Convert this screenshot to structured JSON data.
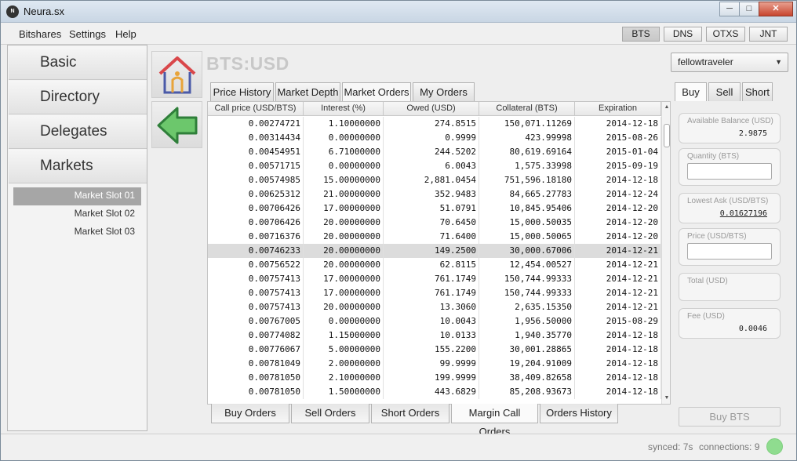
{
  "window": {
    "title": "Neura.sx",
    "icon": "app-logo-icon"
  },
  "window_controls": [
    "minimize",
    "maximize",
    "close"
  ],
  "menu": {
    "items": [
      "Bitshares",
      "Settings",
      "Help"
    ]
  },
  "market_switch": {
    "items": [
      "BTS",
      "DNS",
      "OTXS",
      "JNT"
    ],
    "active": "BTS"
  },
  "nav": {
    "items": [
      "Basic",
      "Directory",
      "Delegates",
      "Markets"
    ]
  },
  "slots": {
    "items": [
      "Market Slot 01",
      "Market Slot 02",
      "Market Slot 03"
    ],
    "active": "Market Slot 01"
  },
  "side_icons": [
    "home-icon",
    "back-arrow-icon"
  ],
  "market": {
    "title": "BTS:USD"
  },
  "account": {
    "selected": "fellowtraveler"
  },
  "tabs": {
    "items": [
      "Price History",
      "Market Depth",
      "Market Orders",
      "My Orders"
    ],
    "active": "Market Orders"
  },
  "table": {
    "columns": [
      "Call price (USD/BTS)",
      "Interest (%)",
      "Owed (USD)",
      "Collateral (BTS)",
      "Expiration"
    ],
    "selected_row": 9,
    "rows": [
      [
        "0.00274721",
        "1.10000000",
        "274.8515",
        "150,071.11269",
        "2014-12-18"
      ],
      [
        "0.00314434",
        "0.00000000",
        "0.9999",
        "423.99998",
        "2015-08-26"
      ],
      [
        "0.00454951",
        "6.71000000",
        "244.5202",
        "80,619.69164",
        "2015-01-04"
      ],
      [
        "0.00571715",
        "0.00000000",
        "6.0043",
        "1,575.33998",
        "2015-09-19"
      ],
      [
        "0.00574985",
        "15.00000000",
        "2,881.0454",
        "751,596.18180",
        "2014-12-18"
      ],
      [
        "0.00625312",
        "21.00000000",
        "352.9483",
        "84,665.27783",
        "2014-12-24"
      ],
      [
        "0.00706426",
        "17.00000000",
        "51.0791",
        "10,845.95406",
        "2014-12-20"
      ],
      [
        "0.00706426",
        "20.00000000",
        "70.6450",
        "15,000.50035",
        "2014-12-20"
      ],
      [
        "0.00716376",
        "20.00000000",
        "71.6400",
        "15,000.50065",
        "2014-12-20"
      ],
      [
        "0.00746233",
        "20.00000000",
        "149.2500",
        "30,000.67006",
        "2014-12-21"
      ],
      [
        "0.00756522",
        "20.00000000",
        "62.8115",
        "12,454.00527",
        "2014-12-21"
      ],
      [
        "0.00757413",
        "17.00000000",
        "761.1749",
        "150,744.99333",
        "2014-12-21"
      ],
      [
        "0.00757413",
        "17.00000000",
        "761.1749",
        "150,744.99333",
        "2014-12-21"
      ],
      [
        "0.00757413",
        "20.00000000",
        "13.3060",
        "2,635.15350",
        "2014-12-21"
      ],
      [
        "0.00767005",
        "0.00000000",
        "10.0043",
        "1,956.50000",
        "2015-08-29"
      ],
      [
        "0.00774082",
        "1.15000000",
        "10.0133",
        "1,940.35770",
        "2014-12-18"
      ],
      [
        "0.00776067",
        "5.00000000",
        "155.2200",
        "30,001.28865",
        "2014-12-18"
      ],
      [
        "0.00781049",
        "2.00000000",
        "99.9999",
        "19,204.91009",
        "2014-12-18"
      ],
      [
        "0.00781050",
        "2.10000000",
        "199.9999",
        "38,409.82658",
        "2014-12-18"
      ],
      [
        "0.00781050",
        "1.50000000",
        "443.6829",
        "85,208.93673",
        "2014-12-18"
      ]
    ]
  },
  "bottom_tabs": {
    "items": [
      "Buy Orders",
      "Sell Orders",
      "Short Orders",
      "Margin Call Orders",
      "Orders History"
    ],
    "active": "Margin Call Orders"
  },
  "order_tabs": {
    "items": [
      "Buy",
      "Sell",
      "Short"
    ],
    "active": "Buy"
  },
  "order_form": {
    "available_balance": {
      "label": "Available Balance (USD)",
      "value": "2.9875"
    },
    "quantity": {
      "label": "Quantity (BTS)",
      "value": ""
    },
    "lowest_ask": {
      "label": "Lowest Ask (USD/BTS)",
      "value": "0.01627196"
    },
    "price": {
      "label": "Price (USD/BTS)",
      "value": ""
    },
    "total": {
      "label": "Total (USD)",
      "value": ""
    },
    "fee": {
      "label": "Fee (USD)",
      "value": "0.0046"
    },
    "submit_label": "Buy BTS"
  },
  "status": {
    "synced": "synced: 7s",
    "connections": "connections: 9",
    "indicator_color": "#8fdc8f"
  }
}
